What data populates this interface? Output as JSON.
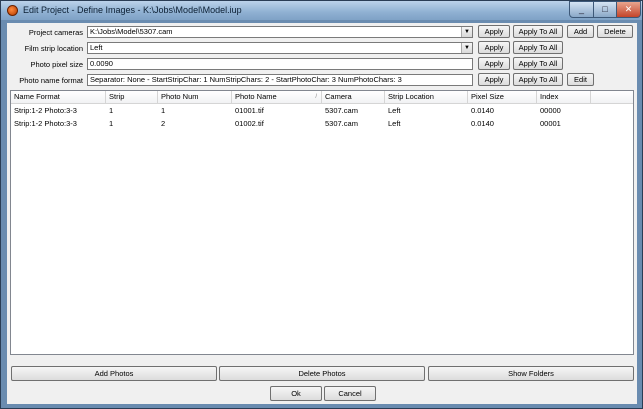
{
  "window": {
    "title": "Edit Project - Define Images - K:\\Jobs\\Model\\Model.iup",
    "icon": "app-orb-icon"
  },
  "titlebar_buttons": {
    "min": "_",
    "max": "□",
    "close": "✕"
  },
  "form": {
    "project_cameras": {
      "label": "Project cameras",
      "value": "K:\\Jobs\\Model\\5307.cam",
      "apply": "Apply",
      "apply_all": "Apply To All",
      "add": "Add",
      "delete": "Delete"
    },
    "film_strip": {
      "label": "Film strip location",
      "value": "Left",
      "apply": "Apply",
      "apply_all": "Apply To All"
    },
    "pixel_size": {
      "label": "Photo pixel size",
      "value": "0.0090",
      "apply": "Apply",
      "apply_all": "Apply To All"
    },
    "name_format": {
      "label": "Photo name format",
      "value": "Separator: None - StartStripChar: 1 NumStripChars: 2 - StartPhotoChar: 3 NumPhotoChars: 3",
      "apply": "Apply",
      "apply_all": "Apply To All",
      "edit": "Edit"
    }
  },
  "table": {
    "columns": [
      "Name Format",
      "Strip",
      "Photo Num",
      "Photo Name",
      "Camera",
      "Strip Location",
      "Pixel Size",
      "Index"
    ],
    "rows": [
      [
        "Strip:1-2 Photo:3-3",
        "1",
        "1",
        "01001.tif",
        "5307.cam",
        "Left",
        "0.0140",
        "00000"
      ],
      [
        "Strip:1-2 Photo:3-3",
        "1",
        "2",
        "01002.tif",
        "5307.cam",
        "Left",
        "0.0140",
        "00001"
      ]
    ]
  },
  "actions": {
    "add_photos": "Add Photos",
    "delete_photos": "Delete Photos",
    "show_folders": "Show Folders",
    "ok": "Ok",
    "cancel": "Cancel"
  },
  "dropdown_glyph": "▼",
  "sort_glyph": "/"
}
